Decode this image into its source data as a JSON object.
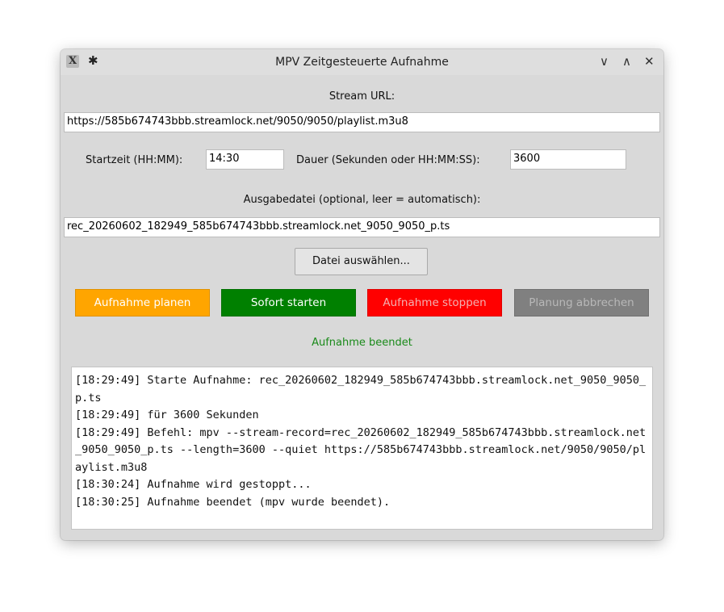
{
  "window": {
    "title": "MPV Zeitgesteuerte Aufnahme",
    "icons": {
      "app": "mpv-app-icon",
      "pin": "pin-icon",
      "minimize": "chevron-down-icon",
      "maximize": "chevron-up-icon",
      "close": "close-icon"
    },
    "glyphs": {
      "app": "X",
      "pin": "✱",
      "minimize": "∨",
      "maximize": "∧",
      "close": "✕"
    }
  },
  "form": {
    "stream_url_label": "Stream URL:",
    "stream_url_value": "https://585b674743bbb.streamlock.net/9050/9050/playlist.m3u8",
    "start_label": "Startzeit (HH:MM):",
    "start_value": "14:30",
    "duration_label": "Dauer (Sekunden oder HH:MM:SS):",
    "duration_value": "3600",
    "output_label": "Ausgabedatei (optional, leer = automatisch):",
    "output_value": "rec_20260602_182949_585b674743bbb.streamlock.net_9050_9050_p.ts",
    "choose_file_button": "Datei auswählen..."
  },
  "actions": {
    "plan": "Aufnahme planen",
    "start_now": "Sofort starten",
    "stop": "Aufnahme stoppen",
    "cancel_plan": "Planung abbrechen"
  },
  "colors": {
    "plan_bg": "#ffa500",
    "start_bg": "#008000",
    "stop_bg": "#ff0000",
    "cancel_bg": "#808080",
    "status_text": "#1a8a1a"
  },
  "status": "Aufnahme beendet",
  "log": [
    "[18:29:49] Starte Aufnahme: rec_20260602_182949_585b674743bbb.streamlock.net_9050_9050_p.ts",
    "[18:29:49] für 3600 Sekunden",
    "[18:29:49] Befehl: mpv --stream-record=rec_20260602_182949_585b674743bbb.streamlock.net_9050_9050_p.ts --length=3600 --quiet https://585b674743bbb.streamlock.net/9050/9050/playlist.m3u8",
    "[18:30:24] Aufnahme wird gestoppt...",
    "[18:30:25] Aufnahme beendet (mpv wurde beendet)."
  ]
}
